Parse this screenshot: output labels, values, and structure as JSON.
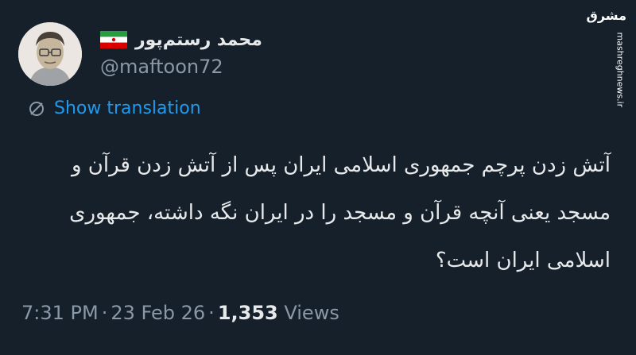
{
  "author": {
    "display_name": "محمد رستم‌پور",
    "handle": "@maftoon72",
    "flag_icon": "iran-flag-icon",
    "avatar_icon": "avatar-portrait"
  },
  "watermark": {
    "logo": "مشرق",
    "site": "mashreghnews.ir"
  },
  "translation": {
    "label": "Show translation",
    "icon": "globe-slash-icon"
  },
  "tweet": {
    "text": "آتش زدن پرچم جمهوری اسلامی ایران پس از آتش زدن قرآن و مسجد یعنی آنچه قرآن و مسجد را در ایران نگه داشته، جمهوری اسلامی ایران است؟"
  },
  "meta": {
    "time": "7:31 PM",
    "date": "23 Feb 26",
    "views_count": "1,353",
    "views_label": "Views"
  },
  "colors": {
    "background": "#15202b",
    "text": "#e7e9ea",
    "muted": "#8b98a5",
    "link": "#1d9bf0"
  }
}
